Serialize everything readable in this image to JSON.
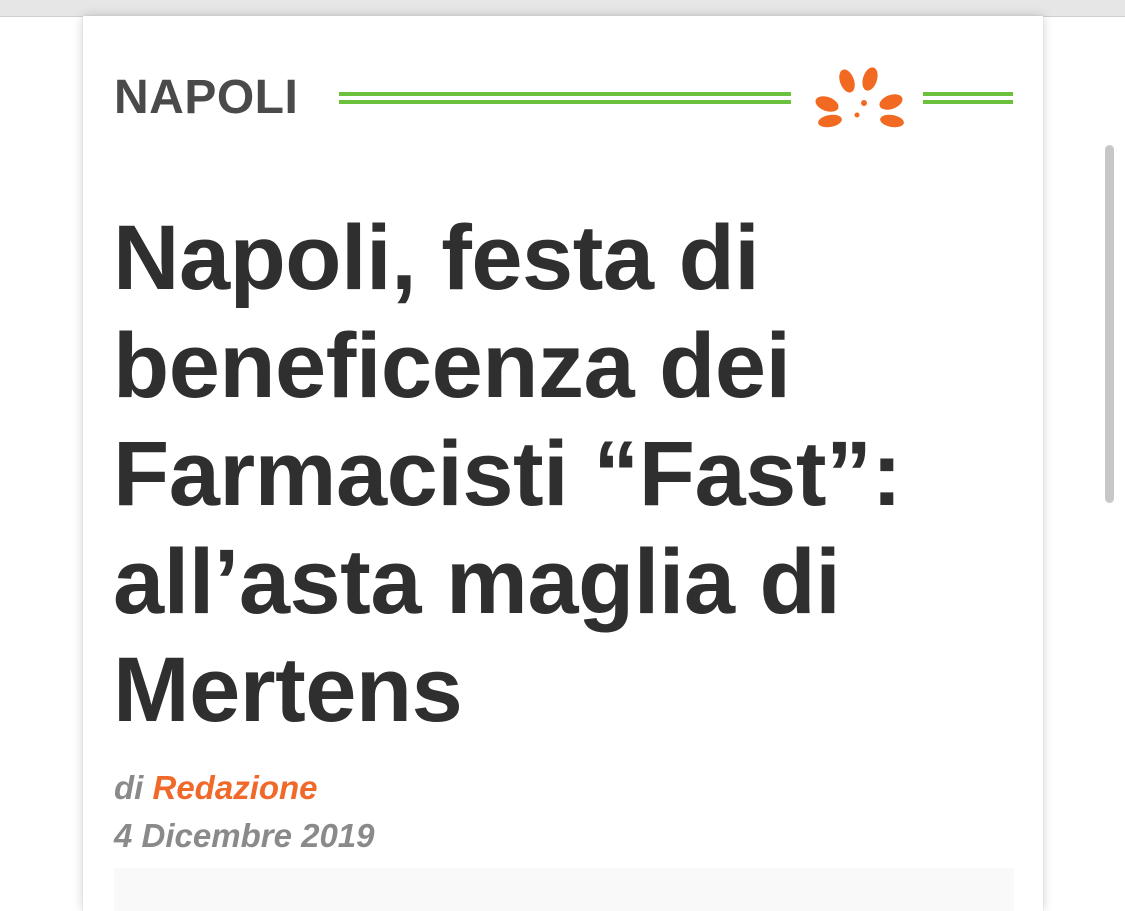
{
  "section": {
    "label": "NAPOLI",
    "rule_color": "#6cc13c",
    "logo_icon": "orange-starburst-logo-icon",
    "logo_color": "#f26a21"
  },
  "article": {
    "headline": "Napoli, festa di beneficenza dei Farmacisti “Fast”: all’asta maglia di Mertens",
    "byline_prefix": "di",
    "author": "Redazione",
    "date": "4 Dicembre 2019"
  },
  "colors": {
    "headline": "#2f2f2f",
    "meta": "#8a8a8a",
    "author_link": "#f1692a"
  }
}
